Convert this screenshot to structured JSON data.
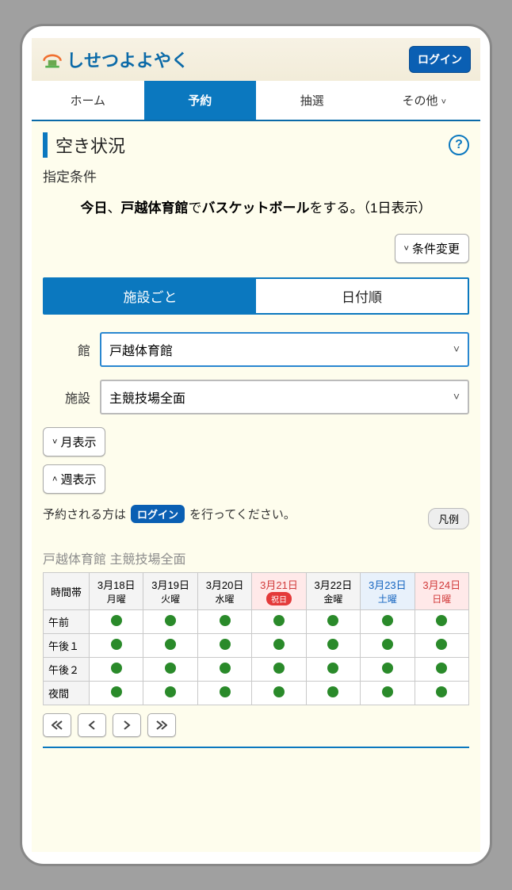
{
  "header": {
    "brand": "しせつよよやく",
    "login": "ログイン"
  },
  "nav": {
    "items": [
      "ホーム",
      "予約",
      "抽選",
      "その他"
    ],
    "active_index": 1
  },
  "page": {
    "title": "空き状況",
    "subtitle": "指定条件",
    "criteria_parts": {
      "p1": "今日",
      "sep1": "、",
      "p2": "戸越体育館",
      "mid": "で",
      "p3": "バスケットボール",
      "tail": "をする。（1日表示）"
    },
    "change_conditions": "条件変更",
    "view_tabs": [
      "施設ごと",
      "日付順"
    ],
    "view_active": 0,
    "field_building_label": "館",
    "field_building_value": "戸越体育館",
    "field_facility_label": "施設",
    "field_facility_value": "主競技場全面",
    "month_view": "月表示",
    "week_view": "週表示",
    "note_prefix": "予約される方は",
    "note_login": "ログイン",
    "note_suffix": "を行ってください。",
    "legend": "凡例",
    "table_title": "戸越体育館 主競技場全面",
    "time_header": "時間帯"
  },
  "dates": [
    {
      "date": "3月18日",
      "dow": "月曜",
      "type": "normal"
    },
    {
      "date": "3月19日",
      "dow": "火曜",
      "type": "normal"
    },
    {
      "date": "3月20日",
      "dow": "水曜",
      "type": "normal"
    },
    {
      "date": "3月21日",
      "dow": "祝日",
      "type": "holiday"
    },
    {
      "date": "3月22日",
      "dow": "金曜",
      "type": "normal"
    },
    {
      "date": "3月23日",
      "dow": "土曜",
      "type": "sat"
    },
    {
      "date": "3月24日",
      "dow": "日曜",
      "type": "sun"
    }
  ],
  "rows": [
    {
      "label": "午前",
      "slots": [
        "avail",
        "avail",
        "avail",
        "avail",
        "avail",
        "avail",
        "avail"
      ]
    },
    {
      "label": "午後１",
      "slots": [
        "avail",
        "avail",
        "avail",
        "avail",
        "avail",
        "avail",
        "avail"
      ]
    },
    {
      "label": "午後２",
      "slots": [
        "avail",
        "avail",
        "avail",
        "avail",
        "avail",
        "avail",
        "avail"
      ]
    },
    {
      "label": "夜間",
      "slots": [
        "avail",
        "avail",
        "avail",
        "avail",
        "avail",
        "avail",
        "avail"
      ]
    }
  ],
  "pager": {
    "first": "◀◀",
    "prev": "◀",
    "next": "▶",
    "last": "▶▶"
  }
}
